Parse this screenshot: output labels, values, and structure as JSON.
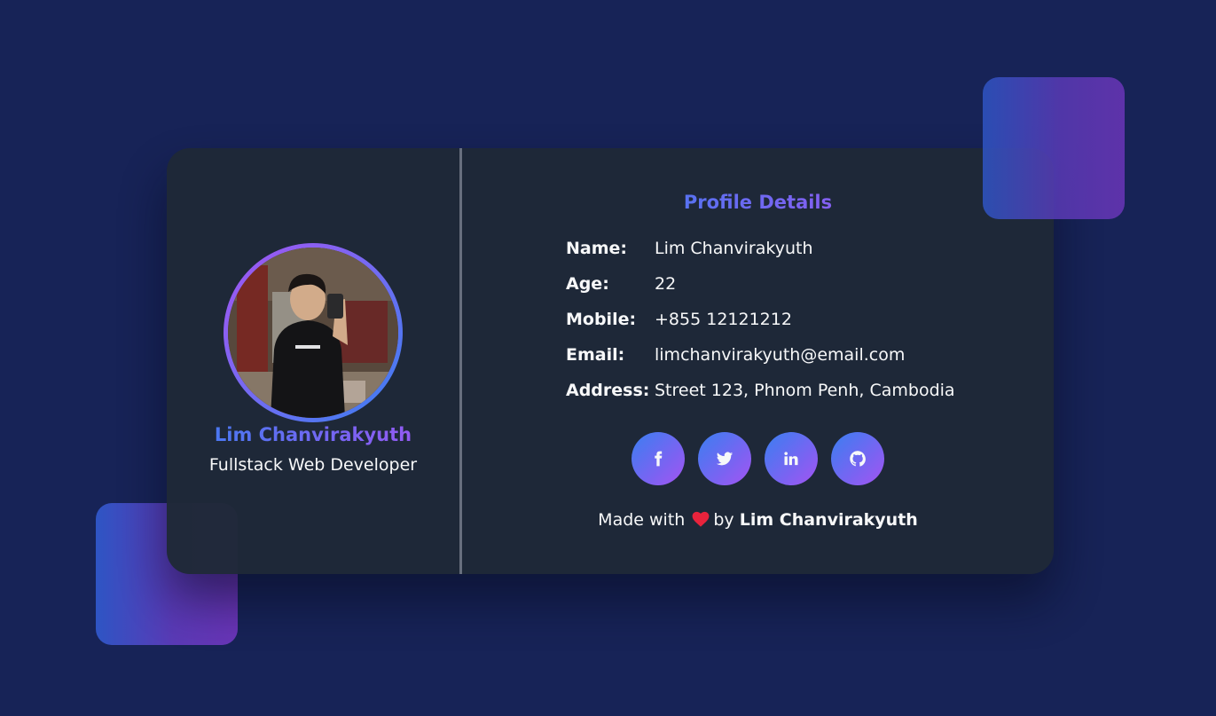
{
  "profile": {
    "name": "Lim Chanvirakyuth",
    "role": "Fullstack Web Developer",
    "avatar_icon": "profile-photo"
  },
  "details": {
    "title": "Profile Details",
    "rows": [
      {
        "label": "Name:",
        "value": "Lim Chanvirakyuth"
      },
      {
        "label": "Age:",
        "value": "22"
      },
      {
        "label": "Mobile:",
        "value": "+855 12121212"
      },
      {
        "label": "Email:",
        "value": "limchanvirakyuth@email.com"
      },
      {
        "label": "Address:",
        "value": "Street 123, Phnom Penh, Cambodia"
      }
    ]
  },
  "social": [
    {
      "icon": "facebook-icon"
    },
    {
      "icon": "twitter-icon"
    },
    {
      "icon": "linkedin-icon"
    },
    {
      "icon": "github-icon"
    }
  ],
  "footer": {
    "prefix": "Made with",
    "heart_icon": "heart-icon",
    "middle": "by",
    "author": "Lim Chanvirakyuth"
  },
  "colors": {
    "background": "#172357",
    "card": "#1f2937",
    "accent_blue": "#3b82f6",
    "accent_purple": "#a855f7",
    "heart": "#ef233c"
  }
}
